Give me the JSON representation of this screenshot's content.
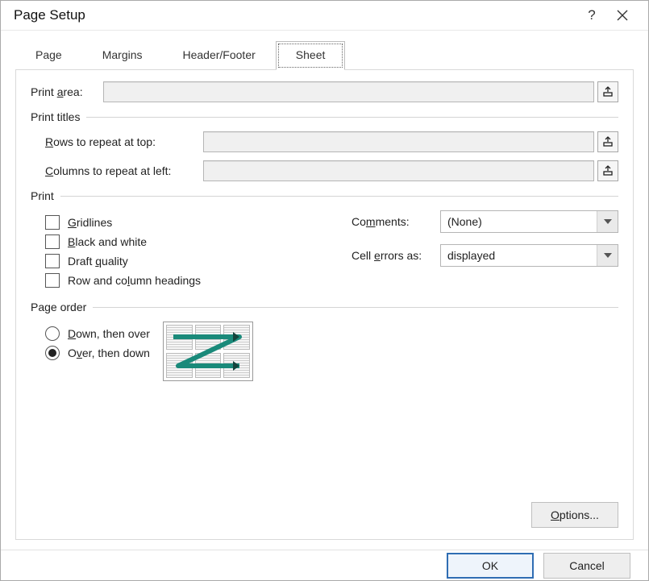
{
  "title": "Page Setup",
  "tabs": {
    "page": "Page",
    "margins": "Margins",
    "headerfooter": "Header/Footer",
    "sheet": "Sheet"
  },
  "activeTab": "sheet",
  "fields": {
    "print_area_label": "Print area:",
    "print_area_value": "",
    "print_titles_label": "Print titles",
    "rows_label": "Rows to repeat at top:",
    "rows_value": "",
    "cols_label": "Columns to repeat at left:",
    "cols_value": "",
    "print_label": "Print",
    "gridlines": "Gridlines",
    "bw": "Black and white",
    "draft": "Draft quality",
    "rowcolhead": "Row and column headings",
    "comments_label": "Comments:",
    "errors_label": "Cell errors as:",
    "comments_value": "(None)",
    "errors_value": "displayed",
    "page_order_label": "Page order",
    "down_over": "Down, then over",
    "over_down": "Over, then down",
    "options": "Options...",
    "ok": "OK",
    "cancel": "Cancel"
  },
  "state": {
    "gridlines": false,
    "bw": false,
    "draft": false,
    "rowcolhead": false,
    "page_order": "over_down"
  }
}
